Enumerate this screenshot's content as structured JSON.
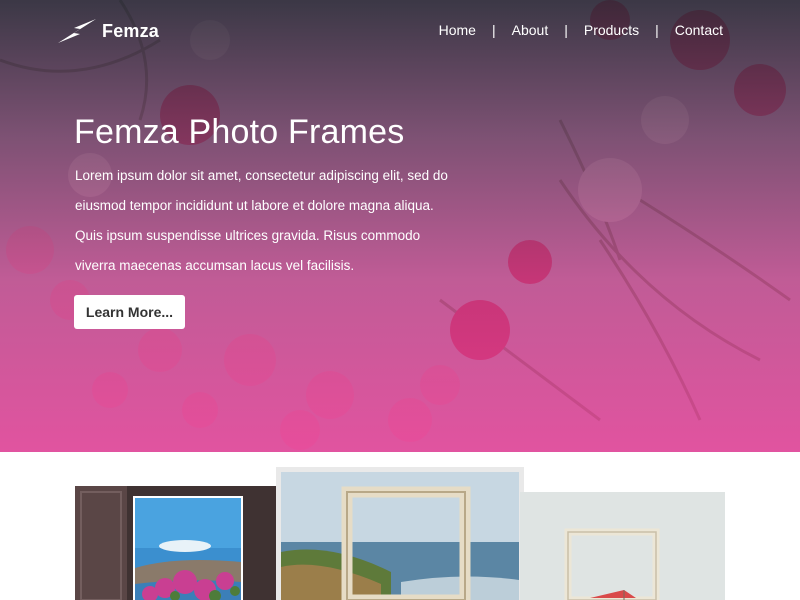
{
  "brand": {
    "name": "Femza",
    "logo_icon": "lightning-bolt-icon"
  },
  "nav": {
    "items": [
      {
        "label": "Home"
      },
      {
        "label": "About"
      },
      {
        "label": "Products"
      },
      {
        "label": "Contact"
      }
    ],
    "separator": "|"
  },
  "hero": {
    "title": "Femza Photo Frames",
    "body": "Lorem ipsum dolor sit amet, consectetur adipiscing elit, sed do eiusmod tempor incididunt ut labore et dolore magna aliqua. Quis ipsum suspendisse ultrices gravida. Risus commodo viverra maecenas accumsan lacus vel facilisis.",
    "cta_label": "Learn More...",
    "background": "pink-flowers-photo",
    "overlay_colors": [
      "#282634",
      "#e83a96"
    ]
  },
  "gallery": {
    "images": [
      "window-sea-view-photo",
      "frame-on-coast-photo",
      "frame-on-grey-wall-photo"
    ]
  },
  "colors": {
    "accent": "#e83a96",
    "text_on_hero": "#ffffff",
    "button_bg": "#ffffff",
    "button_text": "#333333"
  }
}
